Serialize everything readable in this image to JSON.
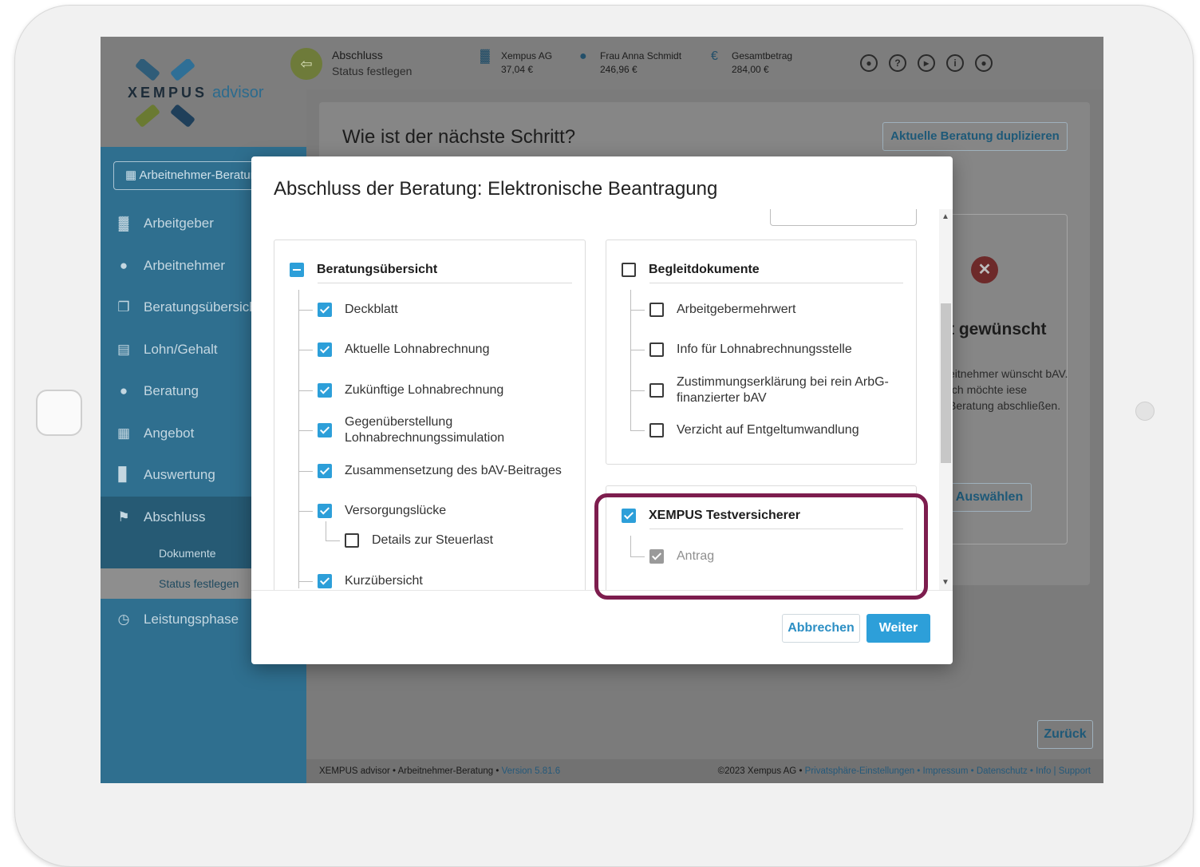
{
  "brand": {
    "logo_text": "XEMPUS",
    "logo_sub": "advisor"
  },
  "sidebar": {
    "selector_label": "Arbeitnehmer-Beratung",
    "items": [
      {
        "label": "Arbeitgeber",
        "icon": "factory-icon"
      },
      {
        "label": "Arbeitnehmer",
        "icon": "person-icon"
      },
      {
        "label": "Beratungsübersicht",
        "icon": "copy-icon"
      },
      {
        "label": "Lohn/Gehalt",
        "icon": "document-icon"
      },
      {
        "label": "Beratung",
        "icon": "people-icon"
      },
      {
        "label": "Angebot",
        "icon": "calculator-icon"
      },
      {
        "label": "Auswertung",
        "icon": "bar-chart-icon"
      },
      {
        "label": "Abschluss",
        "icon": "flag-icon"
      }
    ],
    "sub_items": [
      "Dokumente",
      "Status festlegen"
    ],
    "extra_item": {
      "label": "Leistungsphase",
      "icon": "history-icon"
    }
  },
  "header": {
    "title": "Abschluss",
    "subtitle": "Status festlegen",
    "blocks": [
      {
        "label": "Xempus AG",
        "value": "37,04 €",
        "icon": "factory-icon"
      },
      {
        "label": "Frau Anna Schmidt",
        "value": "246,96 €",
        "icon": "person-icon"
      },
      {
        "label": "Gesamtbetrag",
        "value": "284,00 €",
        "icon": "euro-icon"
      }
    ],
    "icons": [
      "bell-icon",
      "help-icon",
      "play-icon",
      "info-icon",
      "account-icon"
    ]
  },
  "page": {
    "title": "Wie ist der nächste Schritt?",
    "duplicate_button": "Aktuelle Beratung duplizieren",
    "option_title": "t gewünscht",
    "option_text": "eitnehmer wünscht bAV. Ich möchte iese Beratung abschließen.",
    "option_button": "Auswählen",
    "back_button": "Zurück"
  },
  "footer": {
    "left": "XEMPUS advisor • Arbeitnehmer-Beratung • ",
    "version": "Version 5.81.6",
    "right_prefix": "©2023 Xempus AG • ",
    "links": "Privatsphäre-Einstellungen • Impressum • Datenschutz • Info | Support"
  },
  "modal": {
    "title": "Abschluss der Beratung: Elektronische Beantragung",
    "left_panel": {
      "title": "Beratungsübersicht",
      "items": [
        "Deckblatt",
        "Aktuelle Lohnabrechnung",
        "Zukünftige Lohnabrechnung",
        "Gegenüberstellung Lohnabrechnungssimulation",
        "Zusammensetzung des bAV-Beitrages",
        "Versorgungslücke",
        "Details zur Steuerlast",
        "Kurzübersicht"
      ]
    },
    "right_panel": {
      "title": "Begleitdokumente",
      "items": [
        "Arbeitgebermehrwert",
        "Info für Lohnabrechnungsstelle",
        "Zustimmungserklärung bei rein ArbG-finanzierter bAV",
        "Verzicht auf Entgeltumwandlung"
      ]
    },
    "insurer_panel": {
      "title": "XEMPUS Testversicherer",
      "items": [
        "Antrag"
      ]
    },
    "cancel_button": "Abbrechen",
    "next_button": "Weiter"
  },
  "colors": {
    "accent": "#2d9fd9",
    "sidebar": "#2f6f8f",
    "highlight": "#7d1d4e"
  }
}
